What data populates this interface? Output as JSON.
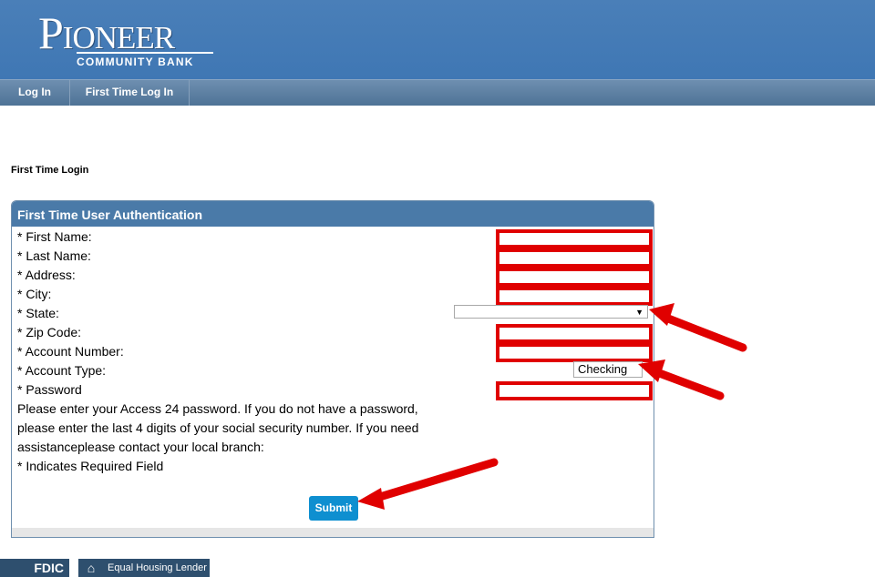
{
  "header": {
    "logo_main": "Pioneer",
    "logo_sub": "COMMUNITY BANK"
  },
  "nav": {
    "items": [
      {
        "label": "Log In"
      },
      {
        "label": "First Time Log In"
      }
    ]
  },
  "page": {
    "title": "First Time Login"
  },
  "form": {
    "title": "First Time User Authentication",
    "fields": {
      "first_name": "* First Name:",
      "last_name": "* Last Name:",
      "address": "* Address:",
      "city": "* City:",
      "state": "* State:",
      "zip": "* Zip Code:",
      "account_number": "* Account Number:",
      "account_type": "* Account Type:",
      "password": "* Password"
    },
    "account_type_value": "Checking",
    "state_value": "",
    "help_lines": [
      "Please enter your Access 24 password. If you do not have a password,",
      "please enter the last 4 digits of your social security number. If you need",
      "assistanceplease contact your local branch:"
    ],
    "required_note": "* Indicates Required Field",
    "submit_label": "Submit"
  },
  "footer": {
    "fdic": "FDIC",
    "equal_housing": "Equal Housing Lender"
  },
  "colors": {
    "header_bg": "#3f77b4",
    "panel_head": "#4a7aa8",
    "submit_bg": "#0e8fd0",
    "annotation_red": "#e00000"
  }
}
